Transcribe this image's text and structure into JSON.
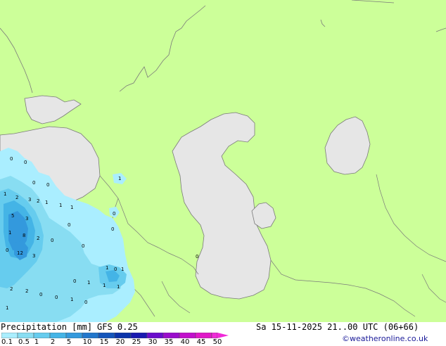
{
  "map": {
    "colors": {
      "land": "#ccff99",
      "water": "#e6e6e6",
      "border": "#7a7a7a"
    },
    "precip_values": [
      "0",
      "0",
      "1",
      "0",
      "0",
      "1",
      "2",
      "3",
      "2",
      "1",
      "1",
      "1",
      "5",
      "3",
      "1",
      "8",
      "2",
      "0",
      "12",
      "3",
      "0",
      "0",
      "0",
      "2",
      "2",
      "0",
      "1",
      "1",
      "0",
      "1",
      "1",
      "1",
      "1",
      "0",
      "1",
      "0",
      "0",
      "0",
      "0",
      "0"
    ]
  },
  "footer": {
    "title": "Precipitation [mm]",
    "model": "GFS 0.25",
    "datetime": "Sa 15-11-2025 21..00 UTC (06+66)",
    "credit": "©weatheronline.co.uk",
    "legend_ticks": [
      "0.1",
      "0.5",
      "1",
      "2",
      "5",
      "10",
      "15",
      "20",
      "25",
      "30",
      "35",
      "40",
      "45",
      "50"
    ],
    "legend_colors": [
      "#aaeeff",
      "#88ddf2",
      "#66ccee",
      "#44b4e6",
      "#3399dd",
      "#2277cc",
      "#1455bb",
      "#0a33aa",
      "#1a1ab0",
      "#6a0ccc",
      "#9a0ccc",
      "#c210cc",
      "#e018c8",
      "#f02ad8"
    ]
  }
}
